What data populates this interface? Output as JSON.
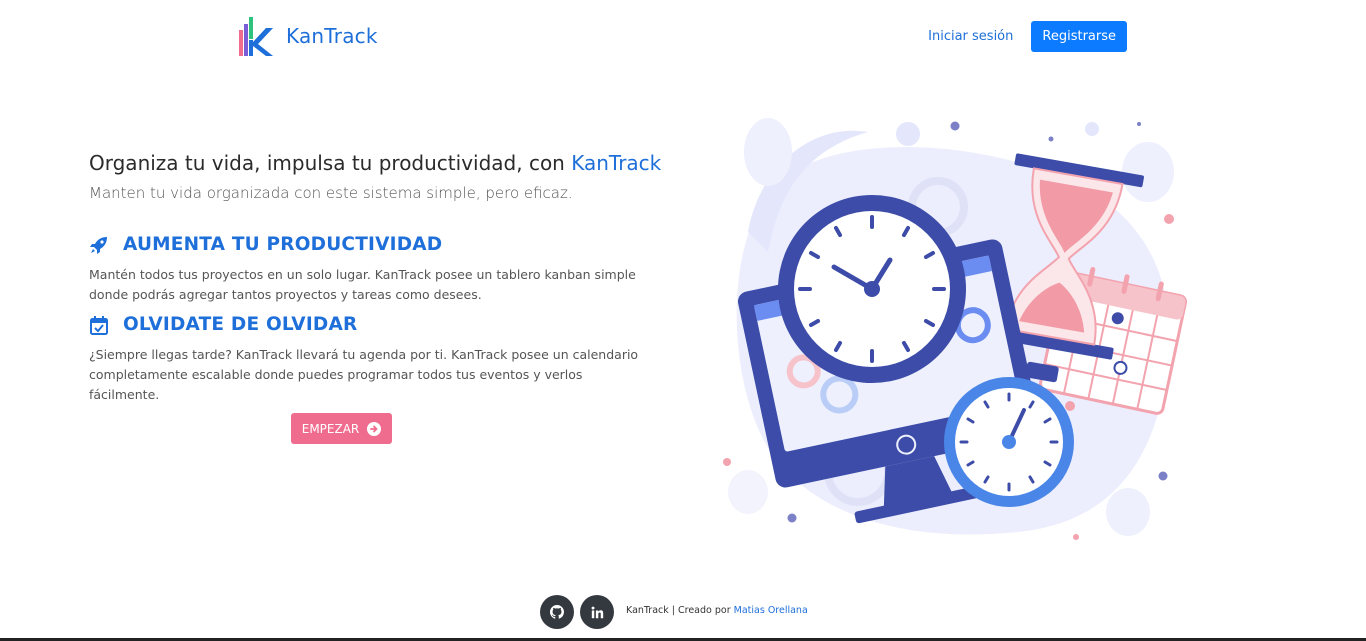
{
  "brand": {
    "name": "KanTrack"
  },
  "nav": {
    "login_label": "Iniciar sesión",
    "register_label": "Registrarse"
  },
  "hero": {
    "title_main": "Organiza tu vida, impulsa tu productividad, con ",
    "title_accent": "KanTrack",
    "subtitle": "Manten tu vida organizada con este sistema simple, pero eficaz."
  },
  "features": [
    {
      "icon": "rocket-icon",
      "title": "AUMENTA TU PRODUCTIVIDAD",
      "text": "Mantén todos tus proyectos en un solo lugar. KanTrack posee un tablero kanban simple donde podrás agregar tantos proyectos y tareas como desees."
    },
    {
      "icon": "calendar-check-icon",
      "title": "OLVIDATE DE OLVIDAR",
      "text": "¿Siempre llegas tarde? KanTrack llevará tu agenda por ti. KanTrack posee un calendario completamente escalable donde puedes programar todos tus eventos y verlos fácilmente."
    }
  ],
  "cta": {
    "start_label": "EMPEZAR"
  },
  "footer": {
    "github_icon": "github-icon",
    "linkedin_icon": "linkedin-icon",
    "credit_prefix": "KanTrack | Creado por ",
    "author": "Matias Orellana"
  },
  "colors": {
    "accent": "#1e6fd9",
    "primary_button": "#0d7bff",
    "start_button": "#f06c8f",
    "social_bg": "#34393f"
  }
}
